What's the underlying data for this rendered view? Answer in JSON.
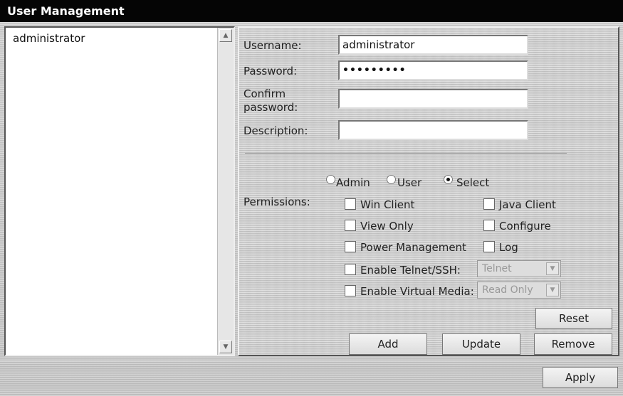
{
  "window": {
    "title": "User Management"
  },
  "users": {
    "items": [
      "administrator"
    ],
    "scroll_up_icon": "triangle-up",
    "scroll_down_icon": "triangle-down"
  },
  "form": {
    "username_label": "Username:",
    "username_value": "administrator",
    "password_label": "Password:",
    "password_value": "•••••••••",
    "confirm_label_line1": "Confirm",
    "confirm_label_line2": "password:",
    "confirm_value": "",
    "description_label": "Description:",
    "description_value": ""
  },
  "roles": {
    "options": [
      "Admin",
      "User",
      "Select"
    ],
    "selected": "Select"
  },
  "permissions": {
    "label": "Permissions:",
    "win_client": "Win Client",
    "java_client": "Java Client",
    "view_only": "View Only",
    "configure": "Configure",
    "power_management": "Power Management",
    "log": "Log",
    "enable_telnet_ssh": "Enable Telnet/SSH:",
    "telnet_select_value": "Telnet",
    "enable_virtual_media": "Enable Virtual Media:",
    "virtual_media_select_value": "Read Only"
  },
  "buttons": {
    "reset": "Reset",
    "add": "Add",
    "update": "Update",
    "remove": "Remove",
    "apply": "Apply"
  }
}
